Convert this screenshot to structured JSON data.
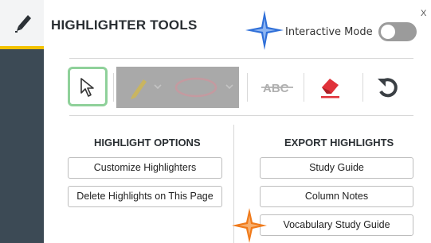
{
  "header": {
    "title": "HIGHLIGHTER TOOLS",
    "close_label": "X",
    "mode_label": "Interactive Mode",
    "mode_on": false
  },
  "toolbar": {
    "tools": [
      "select-pointer",
      "highlighter-pen",
      "highlight-shape",
      "strikethrough-abc",
      "eraser",
      "undo"
    ],
    "strike_label": "ABC",
    "disabled_tools": [
      "highlighter-pen",
      "highlight-shape"
    ]
  },
  "options": {
    "heading": "HIGHLIGHT OPTIONS",
    "buttons": [
      "Customize Highlighters",
      "Delete Highlights on This Page"
    ]
  },
  "export": {
    "heading": "EXPORT HIGHLIGHTS",
    "buttons": [
      "Study Guide",
      "Column Notes",
      "Vocabulary Study Guide"
    ]
  },
  "colors": {
    "sidebar": "#3c4a55",
    "accent": "#f2c200",
    "select_border": "#8fd19a",
    "eraser": "#e0323a",
    "sparkle_blue": "#2f6fd8",
    "sparkle_orange": "#f07a1a"
  }
}
